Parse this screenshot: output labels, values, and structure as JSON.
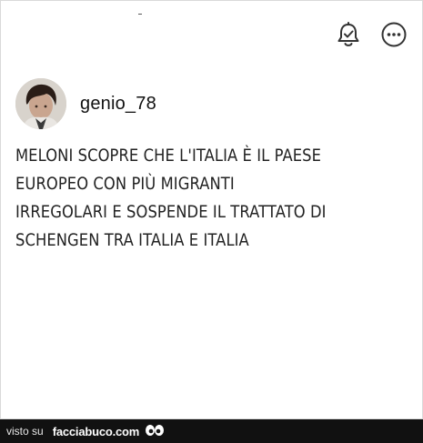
{
  "post": {
    "username": "genio_78",
    "text_lines": [
      "MELONI SCOPRE CHE L'ITALIA È IL PAESE",
      "EUROPEO CON PIÙ MIGRANTI",
      "IRREGOLARI E SOSPENDE IL TRATTATO DI",
      "SCHENGEN TRA ITALIA E ITALIA"
    ]
  },
  "icons": {
    "bell": "bell-check-icon",
    "more": "more-options-icon",
    "eyes": "googly-eyes-icon"
  },
  "footer": {
    "prefix": "visto su",
    "site": "facciabuco.com"
  },
  "colors": {
    "footer_bg": "#111111",
    "text": "#222222",
    "border": "#d9d9d9"
  }
}
